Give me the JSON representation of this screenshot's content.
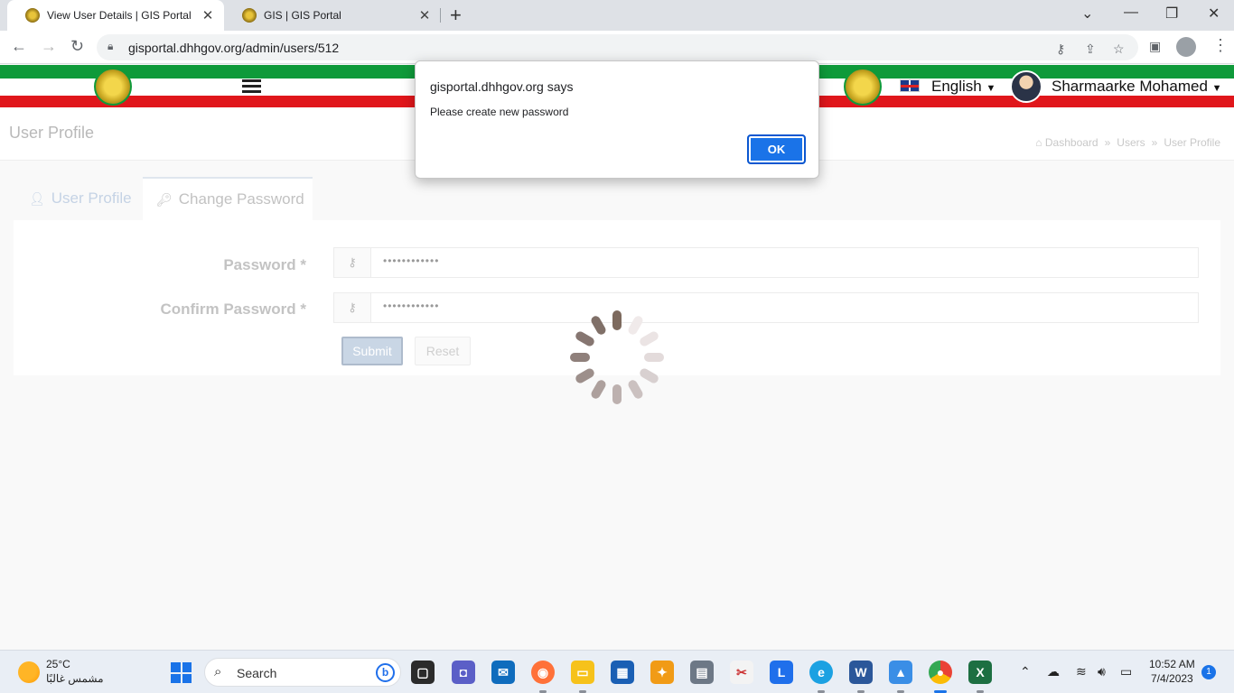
{
  "browser": {
    "tabs": [
      {
        "title": "View User Details | GIS Portal"
      },
      {
        "title": "GIS | GIS Portal"
      }
    ],
    "url": "gisportal.dhhgov.org/admin/users/512"
  },
  "header": {
    "language": "English",
    "user_name": "Sharmaarke Mohamed",
    "colors": {
      "green": "#0f9a3a",
      "red": "#e0161b"
    }
  },
  "page": {
    "title": "User Profile",
    "breadcrumb": [
      "Dashboard",
      "Users",
      "User Profile"
    ],
    "tabs": [
      {
        "label": "User Profile",
        "icon": "user-icon"
      },
      {
        "label": "Change Password",
        "icon": "key-icon"
      }
    ],
    "form": {
      "password_label": "Password *",
      "password_value": "••••••••••••",
      "confirm_label": "Confirm Password *",
      "confirm_value": "••••••••••••",
      "submit_label": "Submit",
      "reset_label": "Reset"
    }
  },
  "dialog": {
    "title": "gisportal.dhhgov.org says",
    "message": "Please create new password",
    "ok_label": "OK"
  },
  "taskbar": {
    "weather_temp": "25°C",
    "weather_desc": "مشمس غالبًا",
    "search_label": "Search",
    "time": "10:52 AM",
    "date": "7/4/2023",
    "notifications": "1"
  }
}
